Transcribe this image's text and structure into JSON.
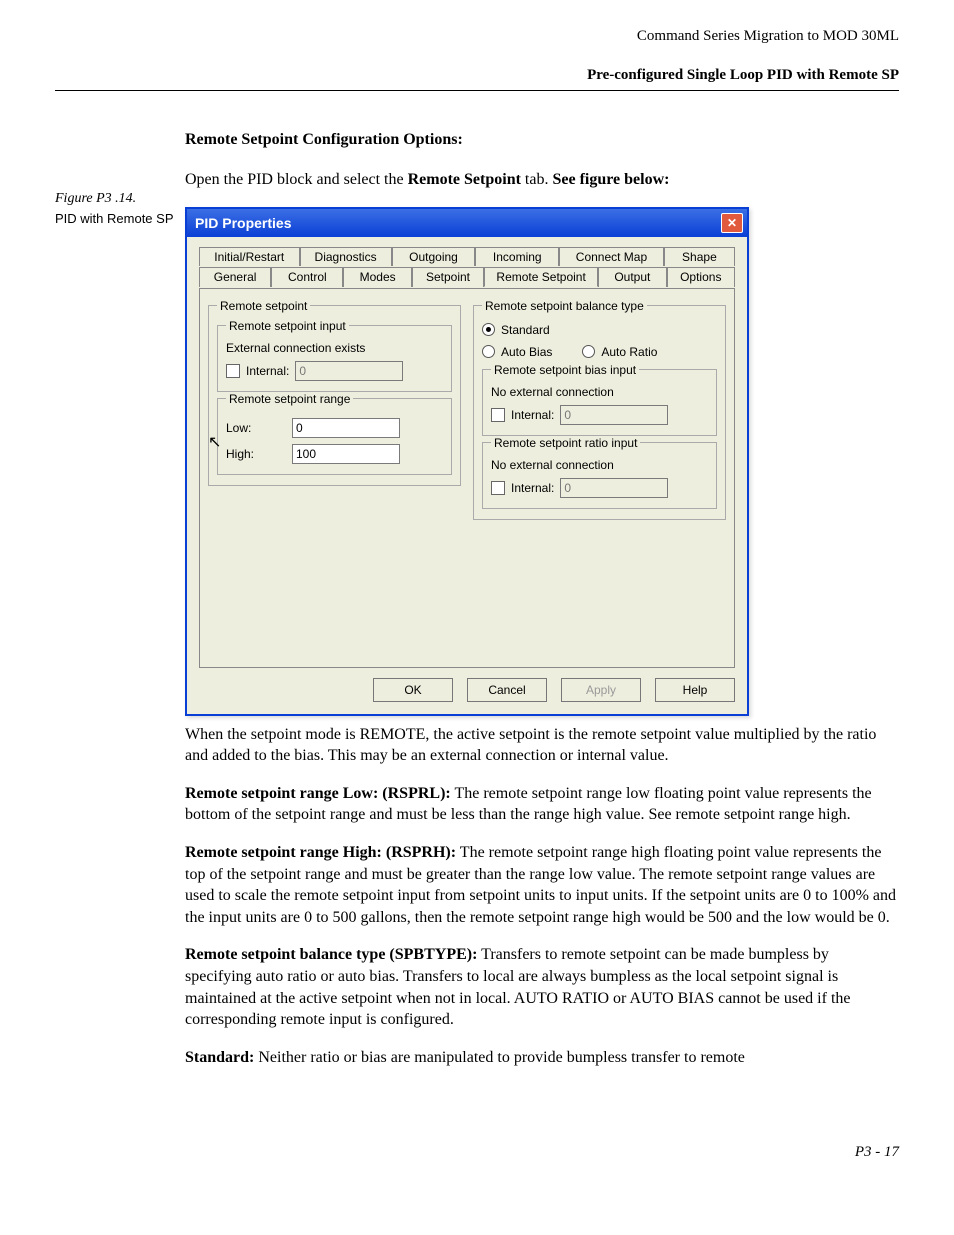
{
  "header": {
    "doc_title": "Command Series Migration to MOD 30ML",
    "section": "Pre-configured Single Loop PID with Remote SP"
  },
  "side": {
    "figure_label": "Figure P3 .14.",
    "figure_desc": "PID with Remote SP"
  },
  "intro": {
    "heading": "Remote Setpoint Configuration Options:",
    "line_a": "Open the PID block and select the ",
    "line_b": "Remote Setpoint",
    "line_c": " tab.",
    "line_d": " See figure below:"
  },
  "dialog": {
    "title": "PID Properties",
    "tabs_row1": [
      "Initial/Restart",
      "Diagnostics",
      "Outgoing",
      "Incoming",
      "Connect Map",
      "Shape"
    ],
    "tabs_row2": [
      "General",
      "Control",
      "Modes",
      "Setpoint",
      "Remote Setpoint",
      "Output",
      "Options"
    ],
    "left": {
      "group": "Remote setpoint",
      "input_group": "Remote setpoint input",
      "input_text": "External connection exists",
      "internal_label": "Internal:",
      "internal_value": "0",
      "range_group": "Remote setpoint range",
      "low_label": "Low:",
      "low_value": "0",
      "high_label": "High:",
      "high_value": "100"
    },
    "right": {
      "balance_group": "Remote setpoint balance type",
      "standard": "Standard",
      "autobias": "Auto Bias",
      "autoratio": "Auto Ratio",
      "bias_group": "Remote setpoint bias input",
      "noext": "No external connection",
      "internal_label": "Internal:",
      "bias_value": "0",
      "ratio_group": "Remote setpoint ratio input",
      "ratio_value": "0"
    },
    "buttons": {
      "ok": "OK",
      "cancel": "Cancel",
      "apply": "Apply",
      "help": "Help"
    }
  },
  "body": {
    "p1": "When the setpoint mode is REMOTE, the active setpoint is the remote setpoint value multiplied by the ratio and added to the bias.  This may be an external connection or internal value.",
    "p2b": "Remote setpoint range Low: (RSPRL):",
    "p2": " The remote setpoint range low floating point value represents the bottom of the setpoint range and must be less than the range high value.  See remote setpoint range high.",
    "p3b": "Remote setpoint range High: (RSPRH):",
    "p3": " The remote setpoint range high floating point value represents the top of the setpoint range and must be greater than the range low value.  The remote setpoint range values are used to scale the remote setpoint input from setpoint units to input units.  If the setpoint units are 0 to 100% and the input units are 0 to 500 gallons, then the remote setpoint range high would be 500 and the low would be 0.",
    "p4b": "Remote setpoint balance type (SPBTYPE):",
    "p4": " Transfers to remote setpoint can be made bumpless by specifying auto ratio or auto bias.  Transfers to local are always bumpless as the local setpoint signal is maintained at the active setpoint when not in local.  AUTO RATIO or AUTO BIAS cannot be used if the corresponding remote input is configured.",
    "p5b": "Standard:",
    "p5": "  Neither ratio or bias are manipulated to provide bumpless transfer to remote"
  },
  "footer": {
    "page": "P3 - 17"
  }
}
